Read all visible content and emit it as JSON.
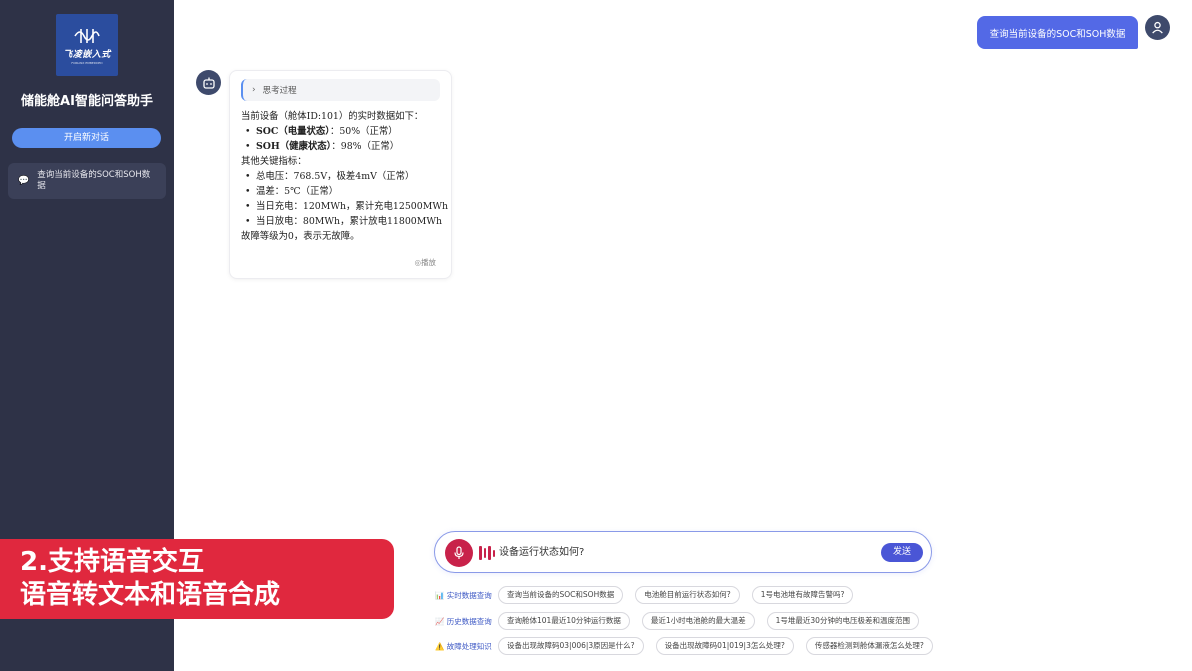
{
  "sidebar": {
    "logo_text": "飞凌嵌入式",
    "logo_sub": "FORLINX EMBEDDED",
    "app_title": "储能舱AI智能问答助手",
    "new_chat_label": "开启新对话",
    "history": [
      {
        "icon": "chat-bubble-icon",
        "label": "查询当前设备的SOC和SOH数据"
      }
    ]
  },
  "conversation": {
    "user_message": "查询当前设备的SOC和SOH数据",
    "bot": {
      "thinking_label": "思考过程",
      "intro": "当前设备（舱体ID:101）的实时数据如下：",
      "primary": [
        {
          "label": "SOC（电量状态）",
          "value": "：50%（正常）"
        },
        {
          "label": "SOH（健康状态）",
          "value": "：98%（正常）"
        }
      ],
      "other_title": "其他关键指标：",
      "metrics": [
        "总电压：768.5V，极差4mV（正常）",
        "温差：5℃（正常）",
        "当日充电：120MWh，累计充电12500MWh",
        "当日放电：80MWh，累计放电11800MWh"
      ],
      "conclusion": "故障等级为0，表示无故障。",
      "play_label": "◎播放"
    }
  },
  "input": {
    "value": "设备运行状态如何?",
    "send_label": "发送"
  },
  "suggestions": [
    {
      "category": "📊 实时数据查询",
      "items": [
        "查询当前设备的SOC和SOH数据",
        "电池舱目前运行状态如何?",
        "1号电池堆有故障告警吗?"
      ]
    },
    {
      "category": "📈 历史数据查询",
      "items": [
        "查询舱体101最近10分钟运行数据",
        "最近1小时电池舱的最大温差",
        "1号堆最近30分钟的电压极差和温度范围"
      ]
    },
    {
      "category": "⚠️ 故障处理知识",
      "items": [
        "设备出现故障码03|006|3原因是什么?",
        "设备出现故障码01|019|3怎么处理?",
        "传感器检测到舱体漏液怎么处理?"
      ]
    }
  ],
  "banner": {
    "line1": "2.支持语音交互",
    "line2": "语音转文本和语音合成"
  },
  "colors": {
    "sidebar_bg": "#2e3247",
    "accent": "#5369e6",
    "banner": "#e0283e",
    "mic": "#c8224a"
  }
}
